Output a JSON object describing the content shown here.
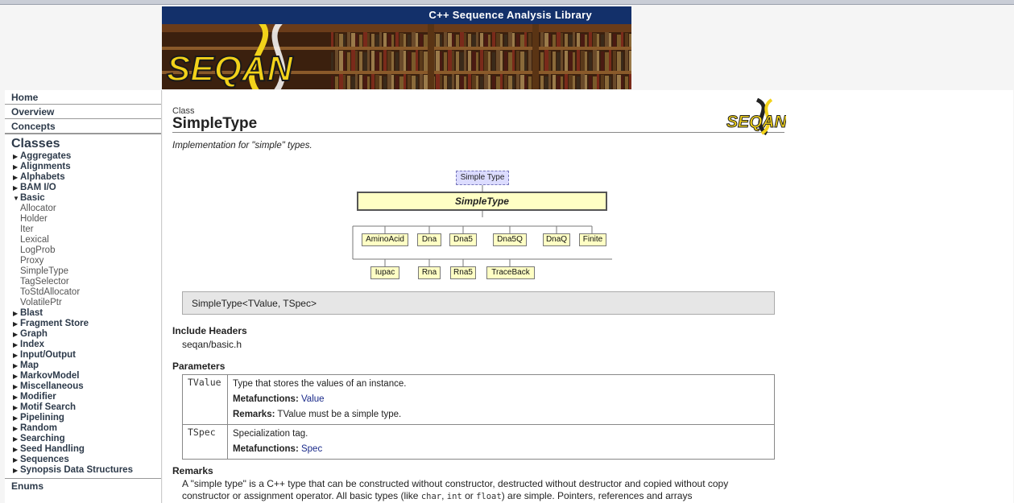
{
  "header": {
    "banner_title": "C++ Sequence Analysis Library",
    "logo_text": "SEQAN"
  },
  "sidebar": {
    "top_links": [
      "Home",
      "Overview",
      "Concepts"
    ],
    "classes_heading": "Classes",
    "categories_before": [
      "Aggregates",
      "Alignments",
      "Alphabets",
      "BAM I/O"
    ],
    "expanded_category": "Basic",
    "basic_items": [
      "Allocator",
      "Holder",
      "Iter",
      "Lexical",
      "LogProb",
      "Proxy",
      "SimpleType",
      "TagSelector",
      "ToStdAllocator",
      "VolatilePtr"
    ],
    "categories_after": [
      "Blast",
      "Fragment Store",
      "Graph",
      "Index",
      "Input/Output",
      "Map",
      "MarkovModel",
      "Miscellaneous",
      "Modifier",
      "Motif Search",
      "Pipelining",
      "Random",
      "Searching",
      "Seed Handling",
      "Sequences",
      "Synopsis Data Structures"
    ],
    "enums_label": "Enums"
  },
  "page": {
    "kind": "Class",
    "name": "SimpleType",
    "logo_text": "SEQAN",
    "summary": "Implementation for \"simple\" types."
  },
  "diagram": {
    "concept": "Simple Type",
    "main": "SimpleType",
    "children_row1": [
      "AminoAcid",
      "Dna",
      "Dna5",
      "Dna5Q",
      "DnaQ",
      "Finite"
    ],
    "children_row2": [
      "Iupac",
      "Rna",
      "Rna5",
      "TraceBack"
    ]
  },
  "signature": "SimpleType<TValue, TSpec>",
  "include": {
    "heading": "Include Headers",
    "file": "seqan/basic.h"
  },
  "parameters": {
    "heading": "Parameters",
    "rows": [
      {
        "name": "TValue",
        "desc": "Type that stores the values of an instance.",
        "meta_label": "Metafunctions:",
        "meta_link": "Value",
        "remarks_label": "Remarks:",
        "remarks": "TValue must be a simple type."
      },
      {
        "name": "TSpec",
        "desc": "Specialization tag.",
        "meta_label": "Metafunctions:",
        "meta_link": "Spec"
      }
    ]
  },
  "remarks": {
    "heading": "Remarks",
    "text_1": "A \"simple type\" is a C++ type that can be constructed without constructor, destructed without destructor and copied without copy constructor or assignment operator. All basic types (like ",
    "code_char": "char",
    "code_int": "int",
    "or_text": " or ",
    "code_float": "float",
    "text_2": ") are simple. Pointers, references and arrays"
  },
  "colors": {
    "banner_bar": "#13306a",
    "diagram_box": "#ffffc4",
    "concept_box": "#dcdcff",
    "logo_yellow": "#f2d21a",
    "link": "#1a2a8a"
  }
}
